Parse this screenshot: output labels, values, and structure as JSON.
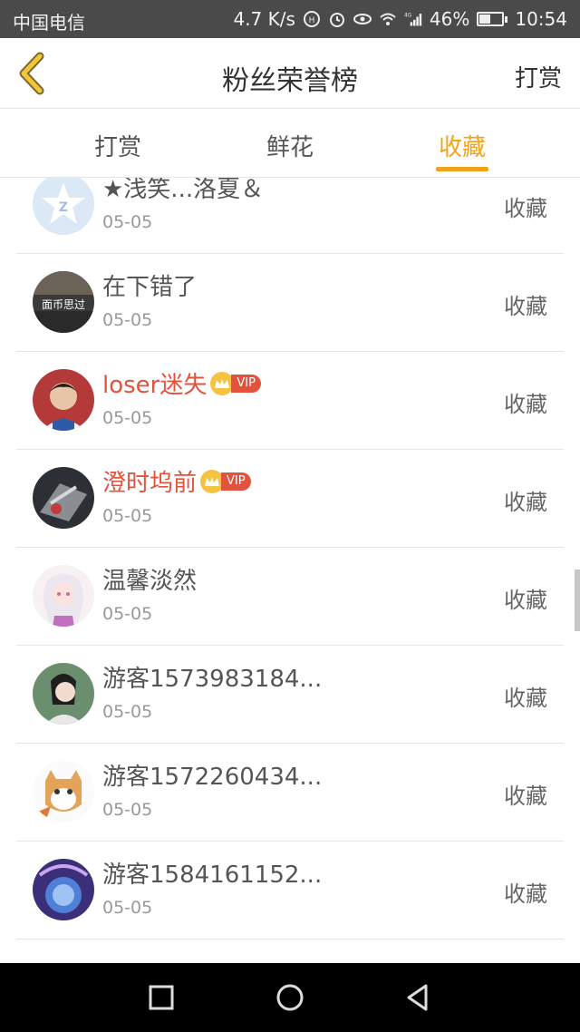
{
  "status_bar": {
    "carrier": "中国电信",
    "speed": "4.7 K/s",
    "network": "4G",
    "battery": "46%",
    "battery_level": 0.46,
    "time": "10:54"
  },
  "header": {
    "title": "粉丝荣誉榜",
    "action": "打赏"
  },
  "tabs": [
    {
      "label": "打赏",
      "active": false
    },
    {
      "label": "鲜花",
      "active": false
    },
    {
      "label": "收藏",
      "active": true
    }
  ],
  "accent_color": "#f0a318",
  "vip_color": "#e2533d",
  "list": [
    {
      "name": "★浅笑...洛夏＆",
      "date": "05-05",
      "action": "收藏",
      "vip": false,
      "vip_label": ""
    },
    {
      "name": "在下错了",
      "date": "05-05",
      "action": "收藏",
      "vip": false,
      "vip_label": "",
      "avatar_text": "面币思过"
    },
    {
      "name": "loser迷失",
      "date": "05-05",
      "action": "收藏",
      "vip": true,
      "vip_label": "VIP"
    },
    {
      "name": "澄时坞前",
      "date": "05-05",
      "action": "收藏",
      "vip": true,
      "vip_label": "VIP"
    },
    {
      "name": "温馨淡然",
      "date": "05-05",
      "action": "收藏",
      "vip": false,
      "vip_label": ""
    },
    {
      "name": "游客1573983184...",
      "date": "05-05",
      "action": "收藏",
      "vip": false,
      "vip_label": ""
    },
    {
      "name": "游客1572260434...",
      "date": "05-05",
      "action": "收藏",
      "vip": false,
      "vip_label": ""
    },
    {
      "name": "游客1584161152...",
      "date": "05-05",
      "action": "收藏",
      "vip": false,
      "vip_label": ""
    }
  ],
  "icons": {
    "back": "chevron-left-icon",
    "nav_recent": "square-icon",
    "nav_home": "circle-icon",
    "nav_back": "triangle-left-icon"
  }
}
